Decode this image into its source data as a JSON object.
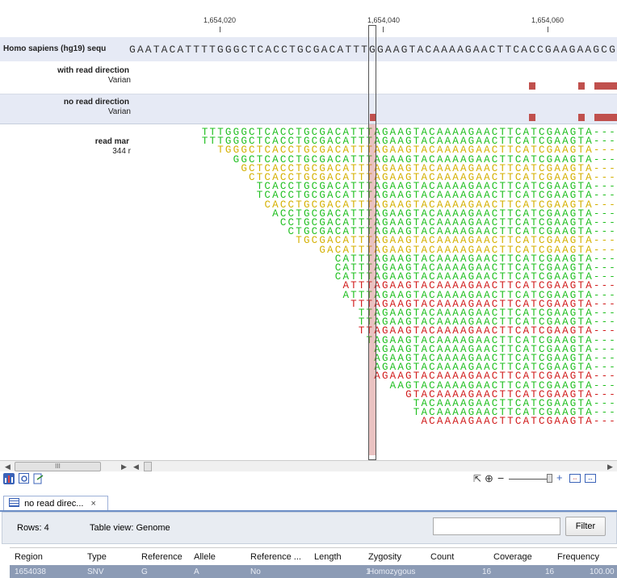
{
  "ruler": {
    "ticks": [
      "1,654,020",
      "1,654,040",
      "1,654,060"
    ]
  },
  "reference": {
    "label": "Homo sapiens (hg19) sequ",
    "sequence": "GAATACATTTTGGGCTCACCTGCGACATTTGGAAGTACAAAAGAACTTCACCGAAGAAGCG"
  },
  "tracks": [
    {
      "title": "with read direction",
      "subtitle": "Varian"
    },
    {
      "title": "no read direction",
      "subtitle": "Varian"
    },
    {
      "title": "read mar",
      "subtitle": "344 r"
    }
  ],
  "reads": [
    "TTTGGGCTCACCTGCGACATTTAGAAGTACAAAAGAACTTCATCGAAGTA---",
    "TTTGGGCTCACCTGCGACATTTAGAAGTACAAAAGAACTTCATCGAAGTA---",
    "TGGGCTCACCTGCGACATTTAGAAGTACAAAAGAACTTCATCGAAGTA---",
    "GGCTCACCTGCGACATTTAGAAGTACAAAAGAACTTCATCGAAGTA---",
    "GCTCACCTGCGACATTTAGAAGTACAAAAGAACTTCATCGAAGTA---",
    "CTCACCTGCGACATTTAGAAGTACAAAAGAACTTCATCGAAGTA---",
    "TCACCTGCGACATTTAGAAGTACAAAAGAACTTCATCGAAGTA---",
    "TCACCTGCGACATTTAGAAGTACAAAAGAACTTCATCGAAGTA---",
    "CACCTGCGACATTTAGAAGTACAAAAGAACTTCATCGAAGTA---",
    "ACCTGCGACATTTAGAAGTACAAAAGAACTTCATCGAAGTA---",
    "CCTGCGACATTTAGAAGTACAAAAGAACTTCATCGAAGTA---",
    "CTGCGACATTTAGAAGTACAAAAGAACTTCATCGAAGTA---",
    "TGCGACATTTAGAAGTACAAAAGAACTTCATCGAAGTA---",
    "GACATTTAGAAGTACAAAAGAACTTCATCGAAGTA---",
    "CATTTAGAAGTACAAAAGAACTTCATCGAAGTA---",
    "CATTTAGAAGTACAAAAGAACTTCATCGAAGTA---",
    "CATTTAGAAGTACAAAAGAACTTCATCGAAGTA---",
    "ATTTAGAAGTACAAAAGAACTTCATCGAAGTA---",
    "ATTTAGAAGTACAAAAGAACTTCATCGAAGTA---",
    "TTTAGAAGTACAAAAGAACTTCATCGAAGTA---",
    "TTAGAAGTACAAAAGAACTTCATCGAAGTA---",
    "TTAGAAGTACAAAAGAACTTCATCGAAGTA---",
    "TTAGAAGTACAAAAGAACTTCATCGAAGTA---",
    "TAGAAGTACAAAAGAACTTCATCGAAGTA---",
    "AGAAGTACAAAAGAACTTCATCGAAGTA---",
    "AGAAGTACAAAAGAACTTCATCGAAGTA---",
    "AGAAGTACAAAAGAACTTCATCGAAGTA---",
    "AGAAGTACAAAAGAACTTCATCGAAGTA---",
    "AAGTACAAAAGAACTTCATCGAAGTA---",
    "GTACAAAAGAACTTCATCGAAGTA---",
    "TACAAAAGAACTTCATCGAAGTA---",
    "TACAAAAGAACTTCATCGAAGTA---",
    "ACAAAAGAACTTCATCGAAGTA---"
  ],
  "read_colors": [
    "green",
    "green",
    "yellow",
    "green",
    "yellow",
    "yellow",
    "green",
    "green",
    "yellow",
    "green",
    "green",
    "green",
    "yellow",
    "yellow",
    "green",
    "green",
    "green",
    "red",
    "green",
    "red",
    "green",
    "green",
    "red",
    "green",
    "green",
    "green",
    "green",
    "red",
    "green",
    "red",
    "green",
    "green",
    "red"
  ],
  "colors": {
    "forward": "#1fbf1f",
    "paired": "#d4b000",
    "reverse": "#d11b1b",
    "variant": "#c0504d",
    "selection": "#6d8fc7"
  },
  "scrollbar": {
    "grip_label": "III"
  },
  "toolbar": {
    "icons": [
      "bar-chart-icon",
      "settings-icon",
      "export-icon"
    ]
  },
  "tab": {
    "label": "no read direc...",
    "close": "×"
  },
  "panel": {
    "rows_label": "Rows: 4",
    "table_view": "Table view: Genome",
    "filter_label": "Filter"
  },
  "table": {
    "headers": [
      "Region",
      "Type",
      "Reference",
      "Allele",
      "Reference ...",
      "Length",
      "Zygosity",
      "Count",
      "Coverage",
      "Frequency"
    ],
    "row": [
      "1654038",
      "SNV",
      "G",
      "A",
      "No",
      "1",
      "Homozygous",
      "16",
      "16",
      "100.00"
    ]
  }
}
